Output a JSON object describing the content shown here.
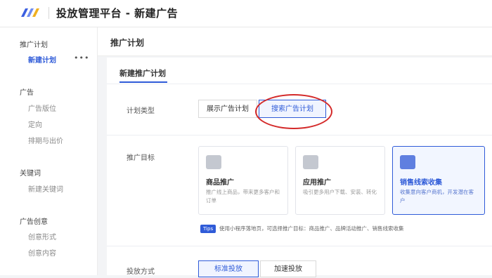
{
  "header": {
    "title": "投放管理平台 - 新建广告",
    "logo_colors": [
      "#3b5fe0",
      "#6f8cf0",
      "#f0b020"
    ]
  },
  "sidebar": {
    "groups": [
      {
        "label": "推广计划",
        "items": [
          {
            "label": "新建计划",
            "active": true
          }
        ]
      },
      {
        "label": "广告",
        "items": [
          {
            "label": "广告版位"
          },
          {
            "label": "定向"
          },
          {
            "label": "排期与出价"
          }
        ]
      },
      {
        "label": "关键词",
        "items": [
          {
            "label": "新建关键词"
          }
        ]
      },
      {
        "label": "广告创意",
        "items": [
          {
            "label": "创意形式"
          },
          {
            "label": "创意内容"
          }
        ]
      }
    ],
    "more_label": "•••"
  },
  "page": {
    "title": "推广计划",
    "tab_label": "新建推广计划"
  },
  "form": {
    "plan_type": {
      "label": "计划类型",
      "options": [
        "展示广告计划",
        "搜索广告计划"
      ],
      "selected": "搜索广告计划"
    },
    "target": {
      "label": "推广目标",
      "cards": [
        {
          "icon": "shopping-bag-icon",
          "title": "商品推广",
          "desc": "推广线上商品，带来更多客户和订单"
        },
        {
          "icon": "app-icon",
          "title": "应用推广",
          "desc": "吸引更多用户下载、安装、转化"
        },
        {
          "icon": "leads-icon",
          "title": "销售线索收集",
          "desc": "收集意向客户商机，开发潜在客户",
          "selected": true
        }
      ],
      "tips_badge": "Tips",
      "tips_text": "使用小程序落地页，可选择推广目标：商品推广、品牌活动推广、销售线索收集"
    },
    "delivery": {
      "label": "投放方式",
      "options": [
        "标准投放",
        "加速投放"
      ],
      "selected": "标准投放"
    }
  },
  "colors": {
    "accent": "#2f5bd8",
    "highlight_circle": "#d42a2a"
  }
}
